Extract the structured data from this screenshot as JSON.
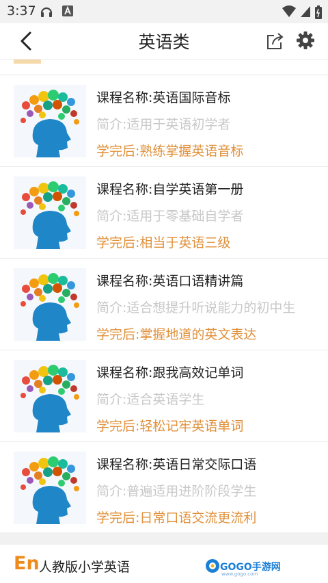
{
  "status_bar": {
    "time": "3:37",
    "icons": [
      "headset-icon",
      "a-badge-icon",
      "wifi-icon",
      "signal-icon",
      "battery-icon"
    ]
  },
  "app_bar": {
    "title": "英语类",
    "back_icon": "back-arrow-icon",
    "share_icon": "share-icon",
    "settings_icon": "gear-icon"
  },
  "courses": [
    {
      "name": "课程名称:英语国际音标",
      "intro": "简介:适用于英语初学者",
      "outcome": "学完后:熟练掌握英语音标"
    },
    {
      "name": "课程名称:自学英语第一册",
      "intro": "简介:适用于零基础自学者",
      "outcome": "学完后:相当于英语三级"
    },
    {
      "name": "课程名称:英语口语精讲篇",
      "intro": "简介:适合想提升听说能力的初中生",
      "outcome": "学完后:掌握地道的英文表达"
    },
    {
      "name": "课程名称:跟我高效记单词",
      "intro": "简介:适合英语学生",
      "outcome": "学完后:轻松记牢英语单词"
    },
    {
      "name": "课程名称:英语日常交际口语",
      "intro": "简介:普遍适用进阶阶段学生",
      "outcome": "学完后:日常口语交流更流利"
    }
  ],
  "footer": {
    "logo": "En",
    "brand_name": "人教版小学英语",
    "watermark": "GOGO手游网",
    "watermark_sub": "www.gogo.com"
  },
  "colors": {
    "accent": "#e0903a",
    "muted": "#c8c8c8",
    "title": "#222222"
  }
}
